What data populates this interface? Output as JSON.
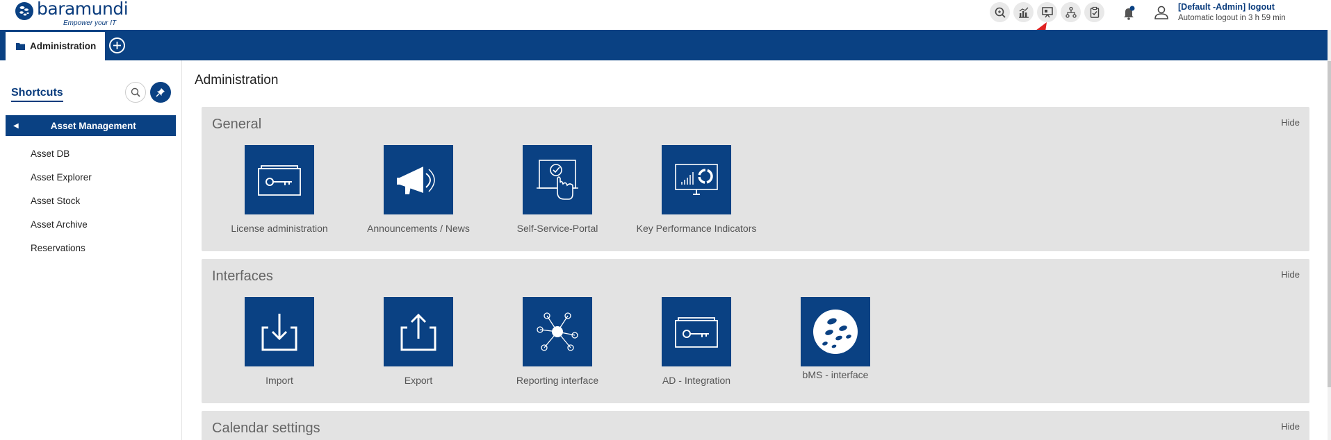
{
  "brand": {
    "name": "baramundi",
    "tagline": "Empower your IT",
    "color": "#0a4183"
  },
  "header": {
    "toolbar_icons": [
      "search-report-icon",
      "statistics-icon",
      "presentation-icon",
      "hierarchy-icon",
      "clipboard-check-icon"
    ],
    "user": "[Default -Admin]",
    "logout_label": "logout",
    "autologout": "Automatic logout in 3 h 59 min"
  },
  "tabs": {
    "active_label": "Administration"
  },
  "sidebar": {
    "title": "Shortcuts",
    "group": "Asset Management",
    "items": [
      "Asset DB",
      "Asset Explorer",
      "Asset Stock",
      "Asset Archive",
      "Reservations"
    ]
  },
  "main": {
    "title": "Administration",
    "hide_label": "Hide",
    "sections": [
      {
        "title": "General",
        "tiles": [
          "License administration",
          "Announcements / News",
          "Self-Service-Portal",
          "Key Performance Indicators"
        ]
      },
      {
        "title": "Interfaces",
        "tiles": [
          "Import",
          "Export",
          "Reporting interface",
          "AD - Integration",
          "bMS - interface"
        ]
      },
      {
        "title": "Calendar settings",
        "tiles": []
      }
    ]
  }
}
